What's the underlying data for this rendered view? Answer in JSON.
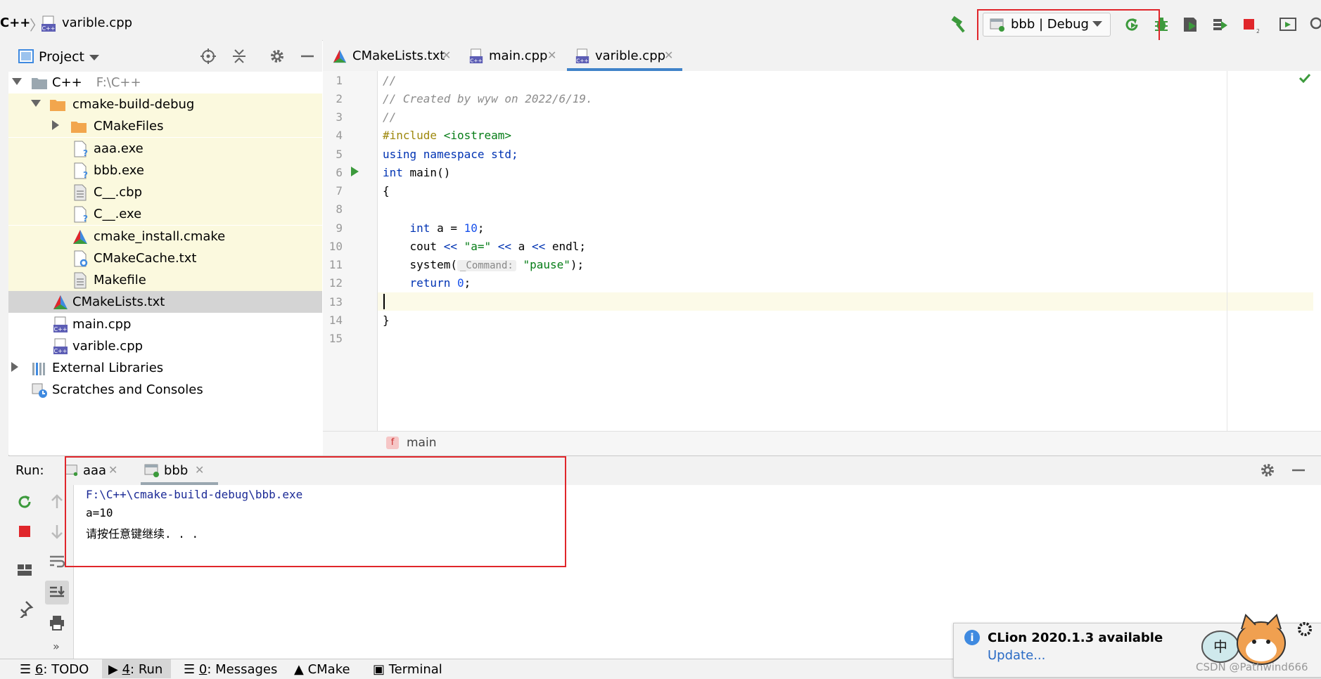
{
  "nav": {
    "root": "C++",
    "separator": "〉",
    "file": "varible.cpp",
    "config_label": "bbb | Debug"
  },
  "project_panel": {
    "title": "Project",
    "tree": [
      {
        "label": "C++",
        "sub": "F:\\C++"
      },
      {
        "label": "cmake-build-debug"
      },
      {
        "label": "CMakeFiles"
      },
      {
        "label": "aaa.exe"
      },
      {
        "label": "bbb.exe"
      },
      {
        "label": "C__.cbp"
      },
      {
        "label": "C__.exe"
      },
      {
        "label": "cmake_install.cmake"
      },
      {
        "label": "CMakeCache.txt"
      },
      {
        "label": "Makefile"
      },
      {
        "label": "CMakeLists.txt"
      },
      {
        "label": "main.cpp"
      },
      {
        "label": "varible.cpp"
      },
      {
        "label": "External Libraries"
      },
      {
        "label": "Scratches and Consoles"
      }
    ]
  },
  "editor": {
    "tabs": [
      {
        "label": "CMakeLists.txt"
      },
      {
        "label": "main.cpp"
      },
      {
        "label": "varible.cpp"
      }
    ],
    "line_numbers": [
      "1",
      "2",
      "3",
      "4",
      "5",
      "6",
      "7",
      "8",
      "9",
      "10",
      "11",
      "12",
      "13",
      "14",
      "15"
    ],
    "code": {
      "l1": "//",
      "l2": "// Created by wyw on 2022/6/19.",
      "l3": "//",
      "l4_a": "#include ",
      "l4_b": "<iostream>",
      "l5_a": "using namespace ",
      "l5_b": "std;",
      "l6_a": "int ",
      "l6_b": "main()",
      "l7": "{",
      "l9_a": "    int ",
      "l9_b": "a = ",
      "l9_c": "10",
      "l9_d": ";",
      "l10_a": "    cout ",
      "l10_b": "<< ",
      "l10_c": "\"a=\"",
      "l10_d": " << ",
      "l10_e": "a ",
      "l10_f": "<< ",
      "l10_g": "endl;",
      "l11_a": "    system(",
      "l11_hint": "_Command:",
      "l11_b": " \"pause\"",
      "l11_c": ");",
      "l12_a": "    return ",
      "l12_b": "0",
      "l12_c": ";",
      "l14": "}"
    },
    "breadcrumb_badge": "f",
    "breadcrumb": "main"
  },
  "run_panel": {
    "title": "Run:",
    "tabs": [
      {
        "label": "aaa"
      },
      {
        "label": "bbb"
      }
    ],
    "console": [
      "F:\\C++\\cmake-build-debug\\bbb.exe",
      "a=10",
      "请按任意键继续. . ."
    ]
  },
  "status_bar": {
    "todo_num": "6",
    "todo": ": TODO",
    "run_num": "4",
    "run": ": Run",
    "messages_num": "0",
    "messages": ": Messages",
    "cmake": "CMake",
    "terminal": "Terminal"
  },
  "notification": {
    "title": "CLion 2020.1.3 available",
    "link": "Update..."
  },
  "watermark": "CSDN @Pathwind666",
  "colors": {
    "highlight_box": "#e0262b",
    "run_green": "#3c9a3c",
    "stop_red": "#e0262b",
    "tab_accent": "#4083c9"
  }
}
